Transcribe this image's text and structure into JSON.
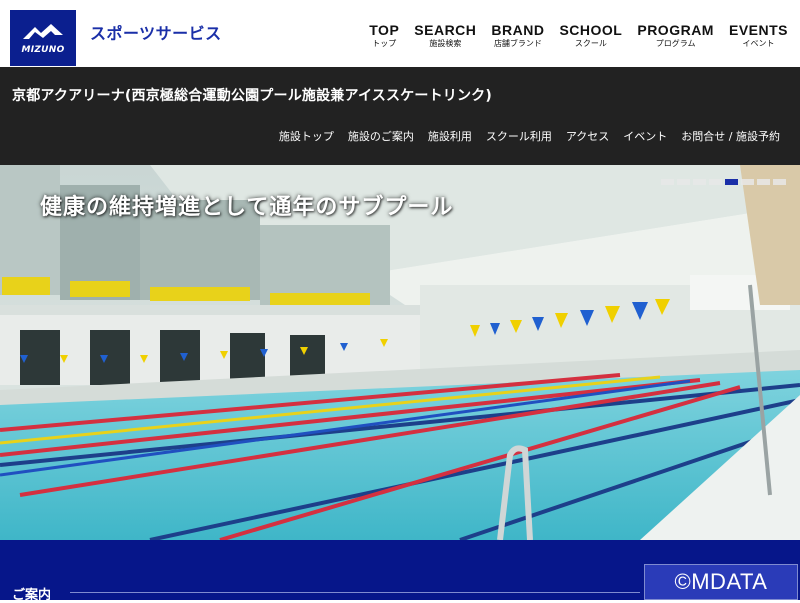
{
  "header": {
    "logo_text": "MIZUNO",
    "site_name": "スポーツサービス",
    "nav": [
      {
        "en": "TOP",
        "ja": "トップ"
      },
      {
        "en": "SEARCH",
        "ja": "施設検索"
      },
      {
        "en": "BRAND",
        "ja": "店舗ブランド"
      },
      {
        "en": "SCHOOL",
        "ja": "スクール"
      },
      {
        "en": "PROGRAM",
        "ja": "プログラム"
      },
      {
        "en": "EVENTS",
        "ja": "イベント"
      }
    ]
  },
  "facility": {
    "title": "京都アクアリーナ(西京極総合運動公園プール施設兼アイススケートリンク)",
    "subnav": [
      "施設トップ",
      "施設のご案内",
      "施設利用",
      "スクール利用",
      "アクセス",
      "イベント",
      "お問合せ / 施設予約"
    ]
  },
  "hero": {
    "caption": "健康の維持増進として通年のサブプール",
    "slide_count": 8,
    "active_slide": 5
  },
  "section": {
    "heading": "ご案内"
  },
  "watermark": "©MDATA",
  "colors": {
    "brand_blue": "#0b1f8f",
    "bar_dark": "#222222",
    "band_blue": "#06168a"
  }
}
